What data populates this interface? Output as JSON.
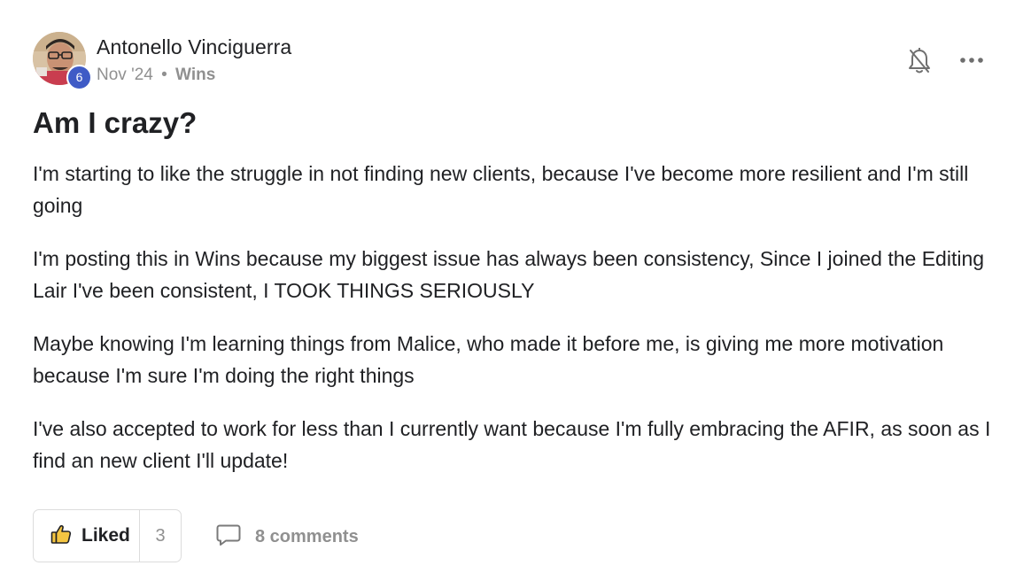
{
  "post": {
    "author": {
      "name": "Antonello Vinciguerra",
      "level": "6",
      "avatar": "user-avatar-photo"
    },
    "meta": {
      "date": "Nov '24",
      "separator": "•",
      "category": "Wins"
    },
    "actions_top": {
      "bell_icon": "bell-off-icon",
      "more_icon": "more-horizontal-icon"
    },
    "title": "Am I crazy?",
    "paragraphs": [
      "I'm starting to like the struggle in not finding new clients, because I've become more resilient and I'm still going",
      "I'm posting this in Wins because my biggest issue has always been consistency, Since I joined the Editing Lair I've been consistent, I TOOK THINGS SERIOUSLY",
      "Maybe knowing I'm learning things from Malice, who made it before me, is giving me more motivation because I'm sure I'm doing the right things",
      "I've also accepted to work for less than I currently want because I'm fully embracing the AFIR, as soon as I find an new client I'll update!"
    ],
    "footer": {
      "like_label": "Liked",
      "like_count": "3",
      "like_icon": "thumbs-up-icon",
      "comments_label": "8 comments",
      "comments_icon": "comment-icon"
    }
  },
  "colors": {
    "text": "#202124",
    "muted": "#909090",
    "badge": "#3f5bc6",
    "border": "#dcdcdc",
    "like_icon_fill": "#f4c542"
  }
}
